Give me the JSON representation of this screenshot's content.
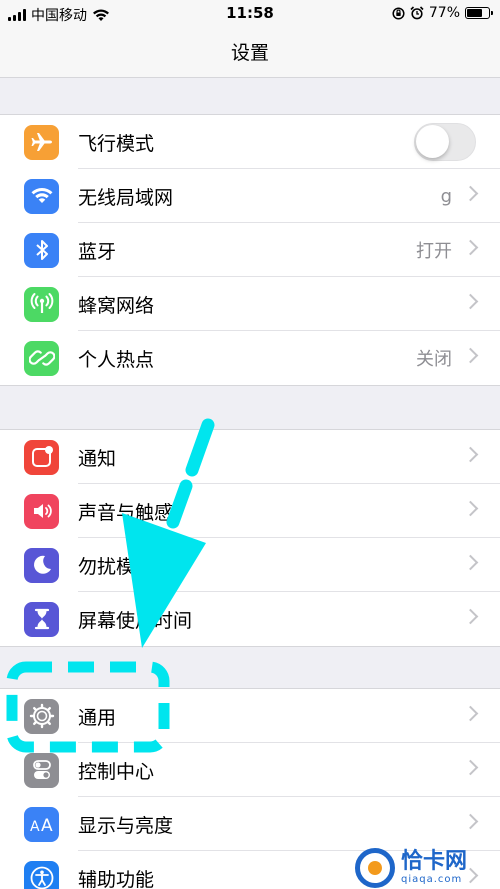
{
  "status_bar": {
    "carrier": "中国移动",
    "time": "11:58",
    "battery": "77%",
    "battery_level": 0.77,
    "icons": [
      "signal-icon",
      "wifi-icon",
      "rotation-lock-icon",
      "alarm-icon",
      "battery-icon"
    ]
  },
  "nav": {
    "title": "设置"
  },
  "groups": [
    {
      "items": [
        {
          "label": "飞行模式",
          "icon": "airplane-icon",
          "color": "#f7a035",
          "control": "toggle",
          "on": false
        },
        {
          "label": "无线局域网",
          "icon": "wifi-icon",
          "color": "#3a82f6",
          "value": "g"
        },
        {
          "label": "蓝牙",
          "icon": "bluetooth-icon",
          "color": "#3a82f6",
          "value": "打开"
        },
        {
          "label": "蜂窝网络",
          "icon": "cellular-icon",
          "color": "#4cd964",
          "value": ""
        },
        {
          "label": "个人热点",
          "icon": "hotspot-icon",
          "color": "#4cd964",
          "value": "关闭"
        }
      ]
    },
    {
      "items": [
        {
          "label": "通知",
          "icon": "notifications-icon",
          "color": "#f0453a"
        },
        {
          "label": "声音与触感",
          "icon": "sounds-icon",
          "color": "#f0445e"
        },
        {
          "label": "勿扰模式",
          "icon": "moon-icon",
          "color": "#5856d6"
        },
        {
          "label": "屏幕使用时间",
          "icon": "hourglass-icon",
          "color": "#5856d6"
        }
      ]
    },
    {
      "items": [
        {
          "label": "通用",
          "icon": "gear-icon",
          "color": "#8e8e93"
        },
        {
          "label": "控制中心",
          "icon": "control-center-icon",
          "color": "#8e8e93"
        },
        {
          "label": "显示与亮度",
          "icon": "display-icon",
          "color": "#3a82f6"
        },
        {
          "label": "辅助功能",
          "icon": "accessibility-icon",
          "color": "#1f7ff2"
        }
      ]
    }
  ],
  "annotation": {
    "color": "#00e5ee",
    "arrow_icon": "annotation-arrow",
    "box_icon": "annotation-dashed-box"
  },
  "watermark": {
    "name": "恰卡网",
    "domain": "qiaqa.com"
  }
}
